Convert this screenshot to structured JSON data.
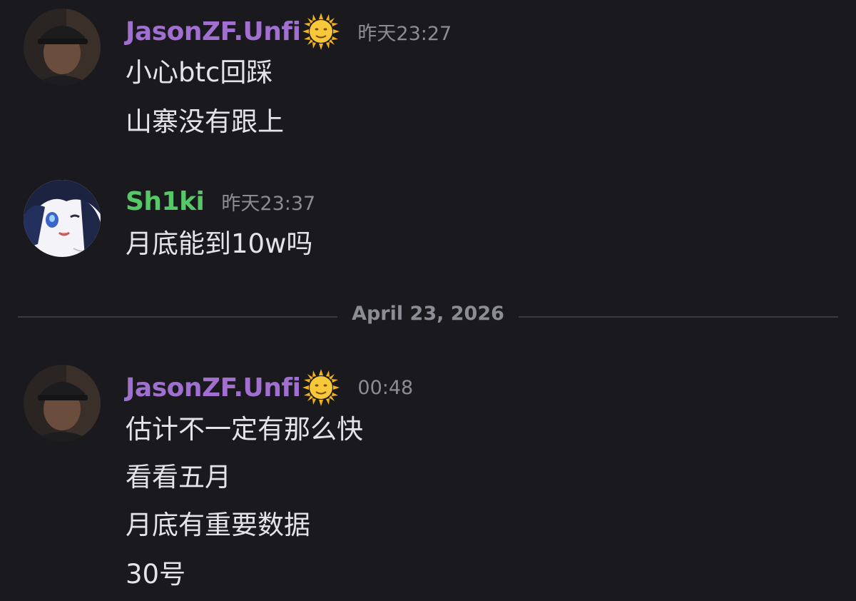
{
  "messages": [
    {
      "username": "JasonZF.Unfi",
      "username_color": "#a06fd0",
      "badge_icon": "sun-face-icon",
      "timestamp": "昨天23:27",
      "lines": [
        "小心btc回踩",
        "山寨没有跟上"
      ]
    },
    {
      "username": "Sh1ki",
      "username_color": "#57c867",
      "timestamp": "昨天23:37",
      "lines": [
        "月底能到10w吗"
      ]
    },
    {
      "username": "JasonZF.Unfi",
      "username_color": "#a06fd0",
      "badge_icon": "sun-face-icon",
      "timestamp": "00:48",
      "lines": [
        "估计不一定有那么快",
        "看看五月",
        "月底有重要数据",
        "30号"
      ]
    }
  ],
  "date_divider": "April 23, 2026"
}
